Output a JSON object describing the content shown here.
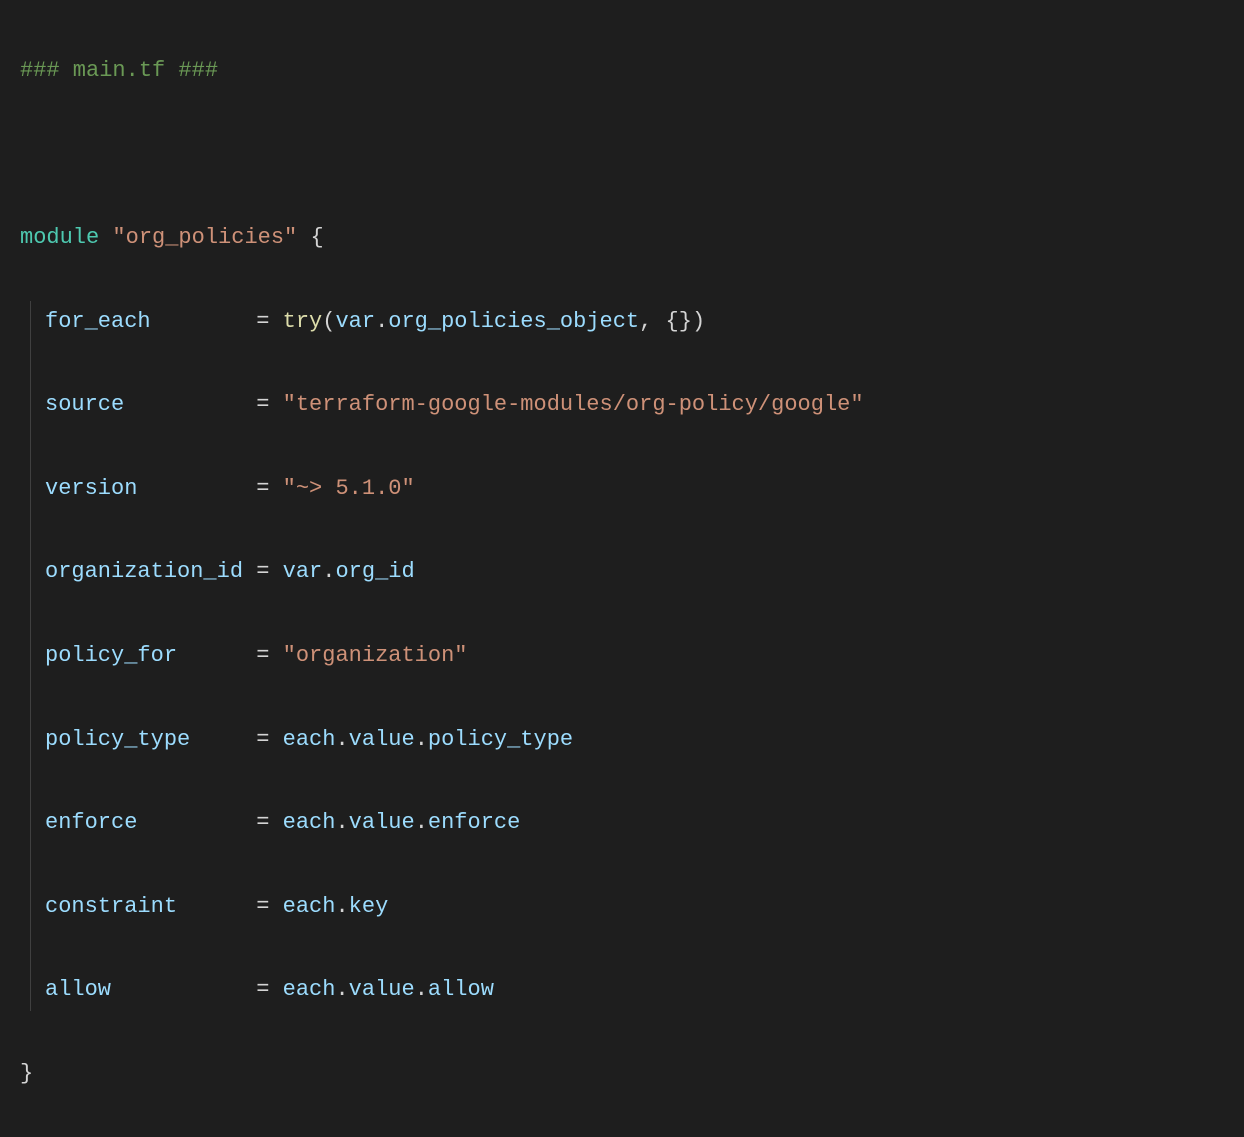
{
  "code": {
    "comment_line": "### main.tf ###",
    "module_keyword": "module",
    "module_name": "\"org_policies\"",
    "open_brace": "{",
    "close_brace": "}",
    "lines": {
      "for_each": {
        "key": "for_each",
        "equals": "=",
        "value_prefix": "try",
        "value_open": "(",
        "value_var": "var",
        "value_dot": ".",
        "value_member": "org_policies_object",
        "value_comma": ",",
        "value_empty": "{}",
        "value_close": ")"
      },
      "source": {
        "key": "source",
        "equals": "=",
        "value": "\"terraform-google-modules/org-policy/google\""
      },
      "version": {
        "key": "version",
        "equals": "=",
        "value": "\"~> 5.1.0\""
      },
      "organization_id": {
        "key": "organization_id",
        "equals": "=",
        "value_var": "var",
        "value_dot": ".",
        "value_member": "org_id"
      },
      "policy_for": {
        "key": "policy_for",
        "equals": "=",
        "value": "\"organization\""
      },
      "policy_type": {
        "key": "policy_type",
        "equals": "=",
        "value_obj": "each",
        "value_dot1": ".",
        "value_mid": "value",
        "value_dot2": ".",
        "value_member": "policy_type"
      },
      "enforce": {
        "key": "enforce",
        "equals": "=",
        "value_obj": "each",
        "value_dot1": ".",
        "value_mid": "value",
        "value_dot2": ".",
        "value_member": "enforce"
      },
      "constraint": {
        "key": "constraint",
        "equals": "=",
        "value_obj": "each",
        "value_dot": ".",
        "value_member": "key"
      },
      "allow": {
        "key": "allow",
        "equals": "=",
        "value_obj": "each",
        "value_dot1": ".",
        "value_mid": "value",
        "value_dot2": ".",
        "value_member": "allow"
      }
    }
  }
}
